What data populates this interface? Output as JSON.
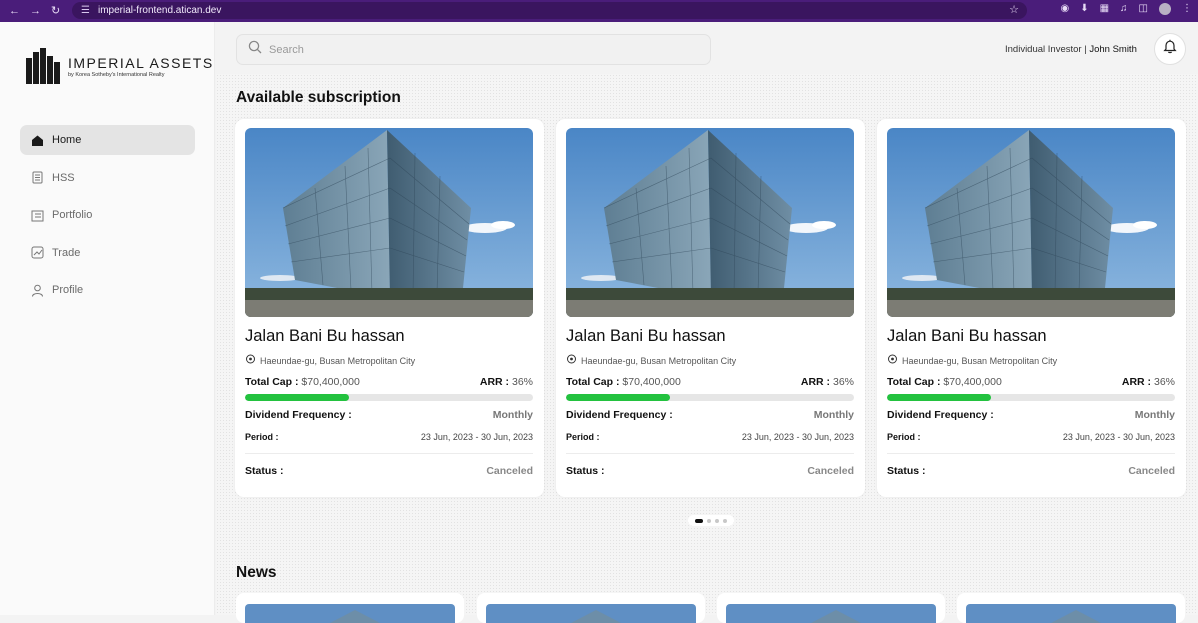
{
  "browser": {
    "url": "imperial-frontend.atican.dev"
  },
  "brand": {
    "name": "IMPERIAL ASSETS",
    "tagline": "by Korea Sotheby's International Realty"
  },
  "sidebar": {
    "items": [
      {
        "label": "Home",
        "icon": "home-icon",
        "active": true
      },
      {
        "label": "HSS",
        "icon": "document-icon",
        "active": false
      },
      {
        "label": "Portfolio",
        "icon": "portfolio-icon",
        "active": false
      },
      {
        "label": "Trade",
        "icon": "trade-chart-icon",
        "active": false
      },
      {
        "label": "Profile",
        "icon": "user-icon",
        "active": false
      }
    ]
  },
  "header": {
    "search_placeholder": "Search",
    "user_role": "Individual Investor",
    "user_separator": " | ",
    "user_name": "John Smith"
  },
  "subscriptions": {
    "title": "Available subscription",
    "cards": [
      {
        "name": "Jalan Bani Bu hassan",
        "location": "Haeundae-gu, Busan Metropolitan City",
        "total_cap_label": "Total Cap :",
        "total_cap_value": "$70,400,000",
        "arr_label": "ARR :",
        "arr_value": "36%",
        "progress": 0.36,
        "dividend_label": "Dividend Frequency :",
        "dividend_value": "Monthly",
        "period_label": "Period :",
        "period_value": "23 Jun, 2023 - 30 Jun, 2023",
        "status_label": "Status :",
        "status_value": "Canceled"
      },
      {
        "name": "Jalan Bani Bu hassan",
        "location": "Haeundae-gu, Busan Metropolitan City",
        "total_cap_label": "Total Cap :",
        "total_cap_value": "$70,400,000",
        "arr_label": "ARR :",
        "arr_value": "36%",
        "progress": 0.36,
        "dividend_label": "Dividend Frequency :",
        "dividend_value": "Monthly",
        "period_label": "Period :",
        "period_value": "23 Jun, 2023 - 30 Jun, 2023",
        "status_label": "Status :",
        "status_value": "Canceled"
      },
      {
        "name": "Jalan Bani Bu hassan",
        "location": "Haeundae-gu, Busan Metropolitan City",
        "total_cap_label": "Total Cap :",
        "total_cap_value": "$70,400,000",
        "arr_label": "ARR :",
        "arr_value": "36%",
        "progress": 0.36,
        "dividend_label": "Dividend Frequency :",
        "dividend_value": "Monthly",
        "period_label": "Period :",
        "period_value": "23 Jun, 2023 - 30 Jun, 2023",
        "status_label": "Status :",
        "status_value": "Canceled"
      }
    ],
    "pager": {
      "pages": 4,
      "current": 1
    }
  },
  "news": {
    "title": "News"
  },
  "colors": {
    "accent_progress": "#23c23f",
    "browser_frame": "#4a1d7a"
  }
}
